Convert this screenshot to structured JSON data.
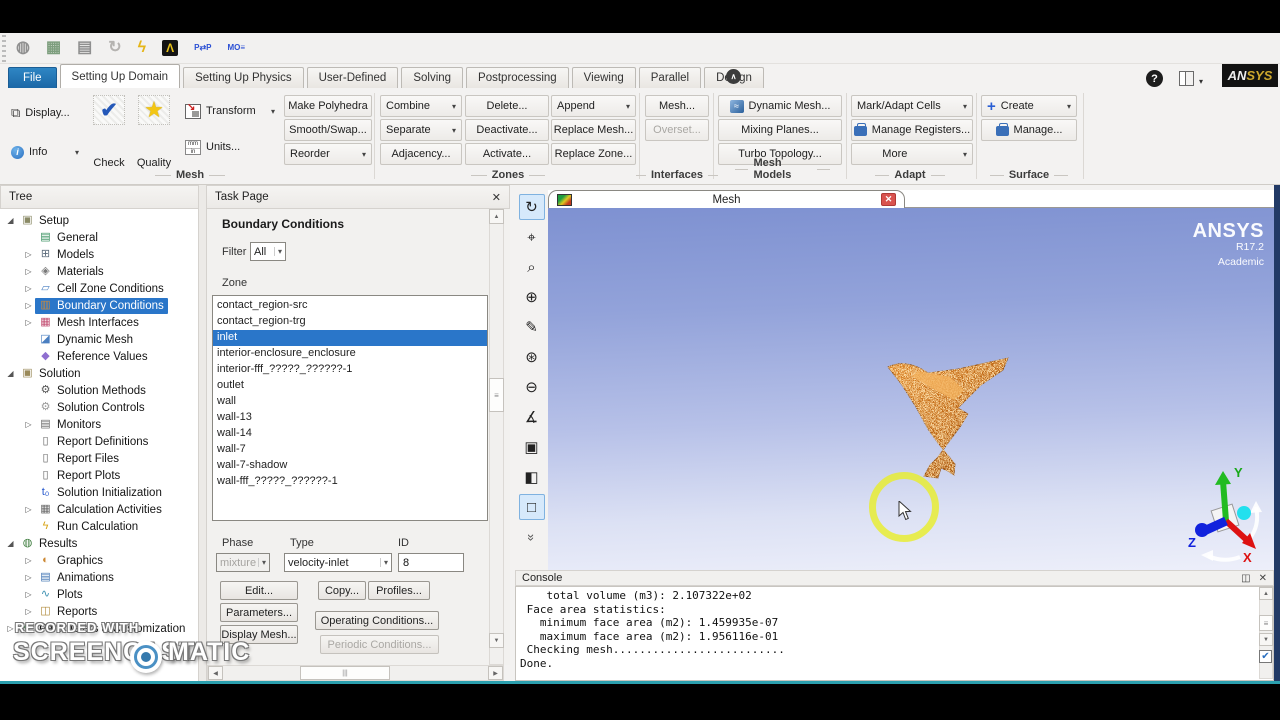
{
  "icons": {
    "close": "✕",
    "caret": "▾",
    "up": "▲",
    "down": "▼",
    "left": "◀",
    "right": "▶",
    "grip": "≡",
    "hgrip": "|||",
    "chevup": "∧",
    "dock": "◫",
    "check": "✔",
    "star": "★",
    "plus": "+",
    "info": "i",
    "qmark": "?",
    "tarrow": "↘",
    "mm": "mm",
    "in": "in",
    "dyn": "≈",
    "conscheck": "✔"
  },
  "quick_toolbar": {
    "icons": [
      {
        "name": "read-mesh-icon",
        "glyph": "◍",
        "color": "#8f8f8f"
      },
      {
        "name": "import-case-icon",
        "glyph": "▦",
        "color": "#7d9e7d"
      },
      {
        "name": "save-case-icon",
        "glyph": "▤",
        "color": "#8f8f8f"
      },
      {
        "name": "refresh-icon",
        "glyph": "↻",
        "color": "#b5b3b0"
      },
      {
        "name": "calculate-icon",
        "glyph": "ϟ",
        "color": "#e5b517"
      },
      {
        "name": "ansys-a-icon",
        "glyph": "Λ",
        "color": "#e8c21a",
        "box": true
      },
      {
        "name": "profile-transfer-icon",
        "glyph": "P⇄P",
        "color": "#2a4fd4",
        "txt": true
      },
      {
        "name": "monitor-eq-icon",
        "glyph": "MO≡",
        "color": "#2a4fd4",
        "txt": true
      }
    ]
  },
  "tabs": {
    "items": [
      {
        "label": "File",
        "file": true
      },
      {
        "label": "Setting Up Domain",
        "active": true
      },
      {
        "label": "Setting Up Physics"
      },
      {
        "label": "User-Defined"
      },
      {
        "label": "Solving"
      },
      {
        "label": "Postprocessing"
      },
      {
        "label": "Viewing"
      },
      {
        "label": "Parallel"
      },
      {
        "label": "Design"
      }
    ]
  },
  "header_right": {
    "logo_an": "AN",
    "logo_sys": "SYS"
  },
  "ribbon": {
    "mesh": {
      "label": "Mesh",
      "display": "Display...",
      "info": "Info",
      "check": "Check",
      "quality": "Quality",
      "transform": "Transform",
      "units": "Units...",
      "make_polyhedra": "Make Polyhedra",
      "smooth_swap": "Smooth/Swap...",
      "reorder": "Reorder"
    },
    "zones": {
      "label": "Zones",
      "combine": "Combine",
      "separate": "Separate",
      "adjacency": "Adjacency...",
      "delete": "Delete...",
      "deactivate": "Deactivate...",
      "activate": "Activate...",
      "append": "Append",
      "replace_mesh": "Replace Mesh...",
      "replace_zone": "Replace Zone..."
    },
    "interfaces": {
      "label": "Interfaces",
      "mesh": "Mesh...",
      "overset": "Overset..."
    },
    "mesh_models": {
      "label": "Mesh Models",
      "dynamic_mesh": "Dynamic Mesh...",
      "mixing_planes": "Mixing Planes...",
      "turbo_topology": "Turbo Topology..."
    },
    "adapt": {
      "label": "Adapt",
      "mark_adapt": "Mark/Adapt Cells",
      "manage_registers": "Manage Registers...",
      "more": "More"
    },
    "surface": {
      "label": "Surface",
      "create": "Create",
      "manage": "Manage..."
    }
  },
  "tree": {
    "header": "Tree",
    "items": [
      {
        "pad": 4,
        "exp": "◢",
        "icon": "▣",
        "icon_color": "#8a8a66",
        "label": "Setup"
      },
      {
        "pad": 22,
        "exp": "",
        "icon": "▤",
        "icon_color": "#2e8b57",
        "label": "General"
      },
      {
        "pad": 22,
        "exp": "▷",
        "icon": "⊞",
        "icon_color": "#5a6a7a",
        "label": "Models"
      },
      {
        "pad": 22,
        "exp": "▷",
        "icon": "◈",
        "icon_color": "#7a7a7a",
        "label": "Materials"
      },
      {
        "pad": 22,
        "exp": "▷",
        "icon": "▱",
        "icon_color": "#4a7fc1",
        "label": "Cell Zone Conditions"
      },
      {
        "pad": 22,
        "exp": "▷",
        "icon": "▥",
        "icon_color": "#cc8a3a",
        "label": "Boundary Conditions",
        "selected": true
      },
      {
        "pad": 22,
        "exp": "▷",
        "icon": "▦",
        "icon_color": "#c14a6f",
        "label": "Mesh Interfaces"
      },
      {
        "pad": 22,
        "exp": "",
        "icon": "◪",
        "icon_color": "#4a7fc1",
        "label": "Dynamic Mesh"
      },
      {
        "pad": 22,
        "exp": "",
        "icon": "◆",
        "icon_color": "#8f6fd0",
        "label": "Reference Values"
      },
      {
        "pad": 4,
        "exp": "◢",
        "icon": "▣",
        "icon_color": "#9a8a5a",
        "label": "Solution"
      },
      {
        "pad": 22,
        "exp": "",
        "icon": "⚙",
        "icon_color": "#555555",
        "label": "Solution Methods"
      },
      {
        "pad": 22,
        "exp": "",
        "icon": "⚙",
        "icon_color": "#9a9a9a",
        "label": "Solution Controls"
      },
      {
        "pad": 22,
        "exp": "▷",
        "icon": "▤",
        "icon_color": "#666666",
        "label": "Monitors"
      },
      {
        "pad": 22,
        "exp": "",
        "icon": "▯",
        "icon_color": "#666666",
        "label": "Report Definitions"
      },
      {
        "pad": 22,
        "exp": "",
        "icon": "▯",
        "icon_color": "#666666",
        "label": "Report Files"
      },
      {
        "pad": 22,
        "exp": "",
        "icon": "▯",
        "icon_color": "#666666",
        "label": "Report Plots"
      },
      {
        "pad": 22,
        "exp": "",
        "icon": "t₀",
        "icon_color": "#2255cc",
        "label": "Solution Initialization"
      },
      {
        "pad": 22,
        "exp": "▷",
        "icon": "▦",
        "icon_color": "#666666",
        "label": "Calculation Activities"
      },
      {
        "pad": 22,
        "exp": "",
        "icon": "ϟ",
        "icon_color": "#d8a418",
        "label": "Run Calculation"
      },
      {
        "pad": 4,
        "exp": "◢",
        "icon": "◍",
        "icon_color": "#3a7a3a",
        "label": "Results"
      },
      {
        "pad": 22,
        "exp": "▷",
        "icon": "◐",
        "icon_color": "#cc8833",
        "label": "Graphics"
      },
      {
        "pad": 22,
        "exp": "▷",
        "icon": "▤",
        "icon_color": "#3a6fb0",
        "label": "Animations"
      },
      {
        "pad": 22,
        "exp": "▷",
        "icon": "∿",
        "icon_color": "#3a8fb0",
        "label": "Plots"
      },
      {
        "pad": 22,
        "exp": "▷",
        "icon": "◫",
        "icon_color": "#b08a3a",
        "label": "Reports"
      },
      {
        "pad": 4,
        "exp": "▷",
        "icon": "❖",
        "icon_color": "#3a9a4a",
        "label": "Parameters & Customization"
      }
    ]
  },
  "task_page": {
    "header": "Task Page",
    "title": "Boundary Conditions",
    "filter_label": "Filter",
    "filter_value": "All",
    "zone_label": "Zone",
    "zones": [
      {
        "label": "contact_region-src"
      },
      {
        "label": "contact_region-trg"
      },
      {
        "label": "inlet",
        "selected": true
      },
      {
        "label": "interior-enclosure_enclosure"
      },
      {
        "label": "interior-fff_?????_??????-1"
      },
      {
        "label": "outlet"
      },
      {
        "label": "wall"
      },
      {
        "label": "wall-13"
      },
      {
        "label": "wall-14"
      },
      {
        "label": "wall-7"
      },
      {
        "label": "wall-7-shadow"
      },
      {
        "label": "wall-fff_?????_??????-1"
      }
    ],
    "phase_label": "Phase",
    "phase_value": "mixture",
    "type_label": "Type",
    "type_value": "velocity-inlet",
    "id_label": "ID",
    "id_value": "8",
    "edit": "Edit...",
    "copy": "Copy...",
    "profiles": "Profiles...",
    "parameters": "Parameters...",
    "operating_conditions": "Operating Conditions...",
    "display_mesh": "Display Mesh...",
    "periodic_conditions": "Periodic Conditions..."
  },
  "graphics": {
    "tab_title": "Mesh",
    "logo_line1": "ANSYS",
    "logo_line2": "R17.2",
    "logo_line3": "Academic",
    "toolbar": [
      {
        "name": "rotate-view-icon",
        "glyph": "↻",
        "active": true
      },
      {
        "name": "pan-icon",
        "glyph": "⌖"
      },
      {
        "name": "zoom-scale-icon",
        "glyph": "⌕"
      },
      {
        "name": "zoom-in-icon",
        "glyph": "⊕"
      },
      {
        "name": "probe-icon",
        "glyph": "✎"
      },
      {
        "name": "zoom-fit-icon",
        "glyph": "⊛"
      },
      {
        "name": "zoom-out-icon",
        "glyph": "⊖"
      },
      {
        "name": "measure-icon",
        "glyph": "∡"
      },
      {
        "name": "snapshot-icon",
        "glyph": "▣"
      },
      {
        "name": "view-options-icon",
        "glyph": "◧",
        "caret": true
      },
      {
        "name": "iso-view-icon",
        "glyph": "□",
        "active": true
      },
      {
        "name": "more-tools-icon",
        "glyph": "»",
        "rot": true
      }
    ]
  },
  "triad": {
    "x": "X",
    "y": "Y",
    "z": "Z"
  },
  "console": {
    "header": "Console",
    "lines": [
      {
        "text": "    total volume (m3): 2.107322e+02"
      },
      {
        "text": " Face area statistics:"
      },
      {
        "text": "   minimum face area (m2): 1.459935e-07"
      },
      {
        "text": "   maximum face area (m2): 1.956116e-01"
      },
      {
        "text": " Checking mesh.........................."
      },
      {
        "text": "Done."
      }
    ]
  },
  "watermark": {
    "line1": "RECORDED WITH",
    "line2": "SCREENCAST",
    "line3": "MATIC"
  }
}
